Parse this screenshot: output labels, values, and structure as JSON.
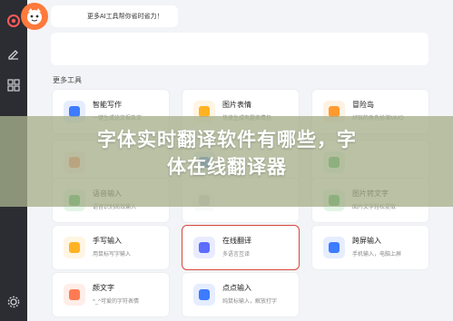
{
  "topbar": {
    "hint": "更多AI工具帮你省时省力！"
  },
  "section": {
    "title": "更多工具"
  },
  "tools": [
    {
      "title": "智能写作",
      "sub": "一键生成论文报告文",
      "icon": "pen-icon",
      "color": "#3d7bff"
    },
    {
      "title": "图片表情",
      "sub": "快速生成有趣表情包",
      "icon": "smile-icon",
      "color": "#ffb323"
    },
    {
      "title": "冒险岛",
      "sub": "好玩的角色扮演MMO",
      "icon": "game-icon",
      "color": "#ff9a2f"
    },
    {
      "title": "",
      "sub": "",
      "icon": "doc-icon",
      "color": "#ff7b54"
    },
    {
      "title": "",
      "sub": "",
      "icon": "image-icon",
      "color": "#3d7bff"
    },
    {
      "title": "",
      "sub": "",
      "icon": "table-icon",
      "color": "#37b24d"
    },
    {
      "title": "语音输入",
      "sub": "语音识别高效输入",
      "icon": "mic-icon",
      "color": "#37b24d"
    },
    {
      "title": "",
      "sub": "",
      "icon": "blank-icon",
      "color": "#cfd6e0"
    },
    {
      "title": "图片转文字",
      "sub": "图片文字轻松提取",
      "icon": "ocr-icon",
      "color": "#37b24d"
    },
    {
      "title": "手写输入",
      "sub": "用鼠标写字输入",
      "icon": "handwrite-icon",
      "color": "#ffb323"
    },
    {
      "title": "在线翻译",
      "sub": "多语言互译",
      "icon": "translate-icon",
      "color": "#5b6cff"
    },
    {
      "title": "跨屏输入",
      "sub": "手机输入，电脑上屏",
      "icon": "cross-screen-icon",
      "color": "#3d7bff"
    },
    {
      "title": "颜文字",
      "sub": "^_^可爱的字符表情",
      "icon": "emoticon-icon",
      "color": "#ff7b54"
    },
    {
      "title": "点点输入",
      "sub": "纯鼠标输入，解放打字",
      "icon": "click-input-icon",
      "color": "#3d7bff"
    }
  ],
  "overlay": {
    "line1": "字体实时翻译软件有哪些，字",
    "line2": "体在线翻译器"
  }
}
